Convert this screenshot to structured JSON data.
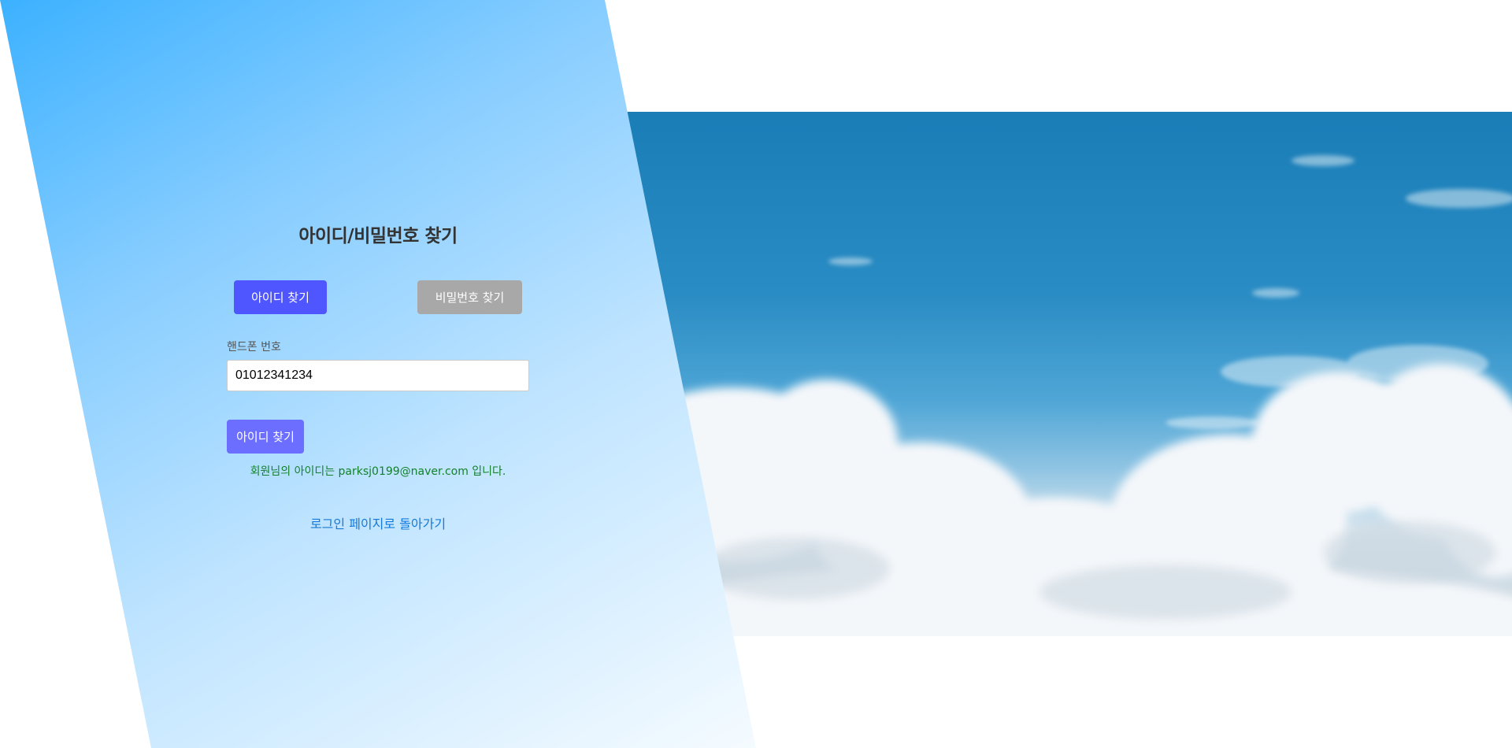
{
  "page": {
    "title": "아이디/비밀번호 찾기"
  },
  "tabs": {
    "find_id": "아이디 찾기",
    "find_password": "비밀번호 찾기",
    "active": "find_id"
  },
  "form": {
    "phone_label": "핸드폰 번호",
    "phone_value": "01012341234",
    "submit_label": "아이디 찾기"
  },
  "result": {
    "message": "회원님의 아이디는 parksj0199@naver.com 입니다."
  },
  "links": {
    "back_to_login": "로그인 페이지로 돌아가기"
  },
  "colors": {
    "active_tab": "#4f55ff",
    "inactive_tab": "#a8a8a8",
    "submit": "#6b6eff",
    "result_text": "#13802a",
    "link": "#1479d8"
  },
  "images": {
    "background_photo": "sky-with-clouds"
  }
}
